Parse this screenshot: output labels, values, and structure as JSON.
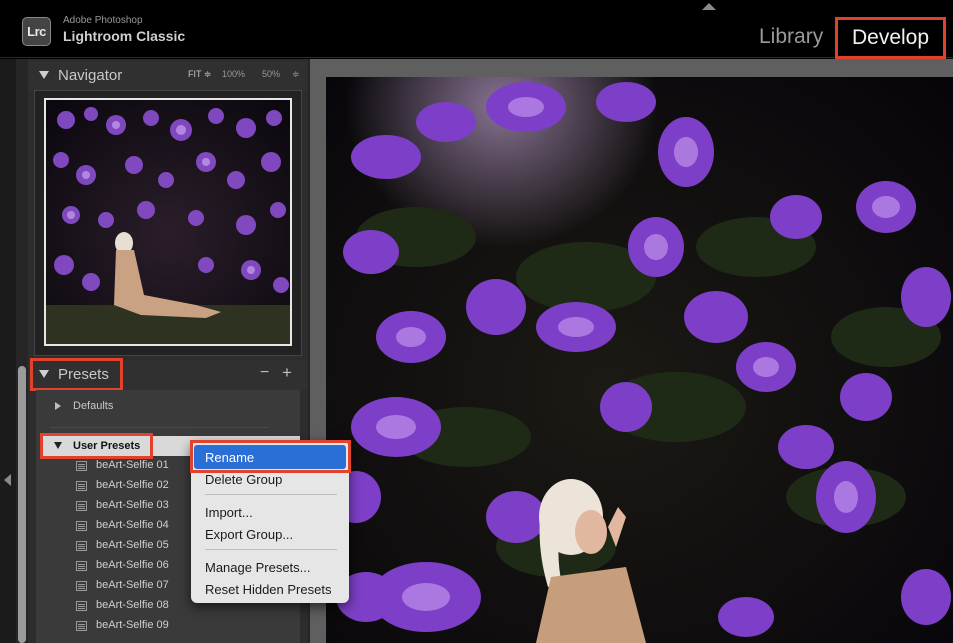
{
  "app": {
    "logo_text": "Lrc",
    "brand_line1": "Adobe Photoshop",
    "brand_line2": "Lightroom Classic"
  },
  "modules": {
    "library": "Library",
    "develop": "Develop"
  },
  "navigator": {
    "title": "Navigator",
    "zoom_fit": "FIT ≑",
    "zoom_100": "100%",
    "zoom_50": "50%",
    "zoom_more": "≑"
  },
  "presets": {
    "title": "Presets",
    "minus": "−",
    "plus": "+",
    "defaults_label": "Defaults",
    "user_presets_label": "User Presets",
    "items": [
      "beArt-Selfie 01",
      "beArt-Selfie 02",
      "beArt-Selfie 03",
      "beArt-Selfie 04",
      "beArt-Selfie 05",
      "beArt-Selfie 06",
      "beArt-Selfie 07",
      "beArt-Selfie 08",
      "beArt-Selfie 09"
    ]
  },
  "context_menu": {
    "rename": "Rename",
    "delete_group": "Delete Group",
    "import": "Import...",
    "export_group": "Export Group...",
    "manage_presets": "Manage Presets...",
    "reset_hidden": "Reset Hidden Presets"
  },
  "colors": {
    "highlight_box": "#e2412b",
    "menu_selection": "#2a6fd6"
  }
}
